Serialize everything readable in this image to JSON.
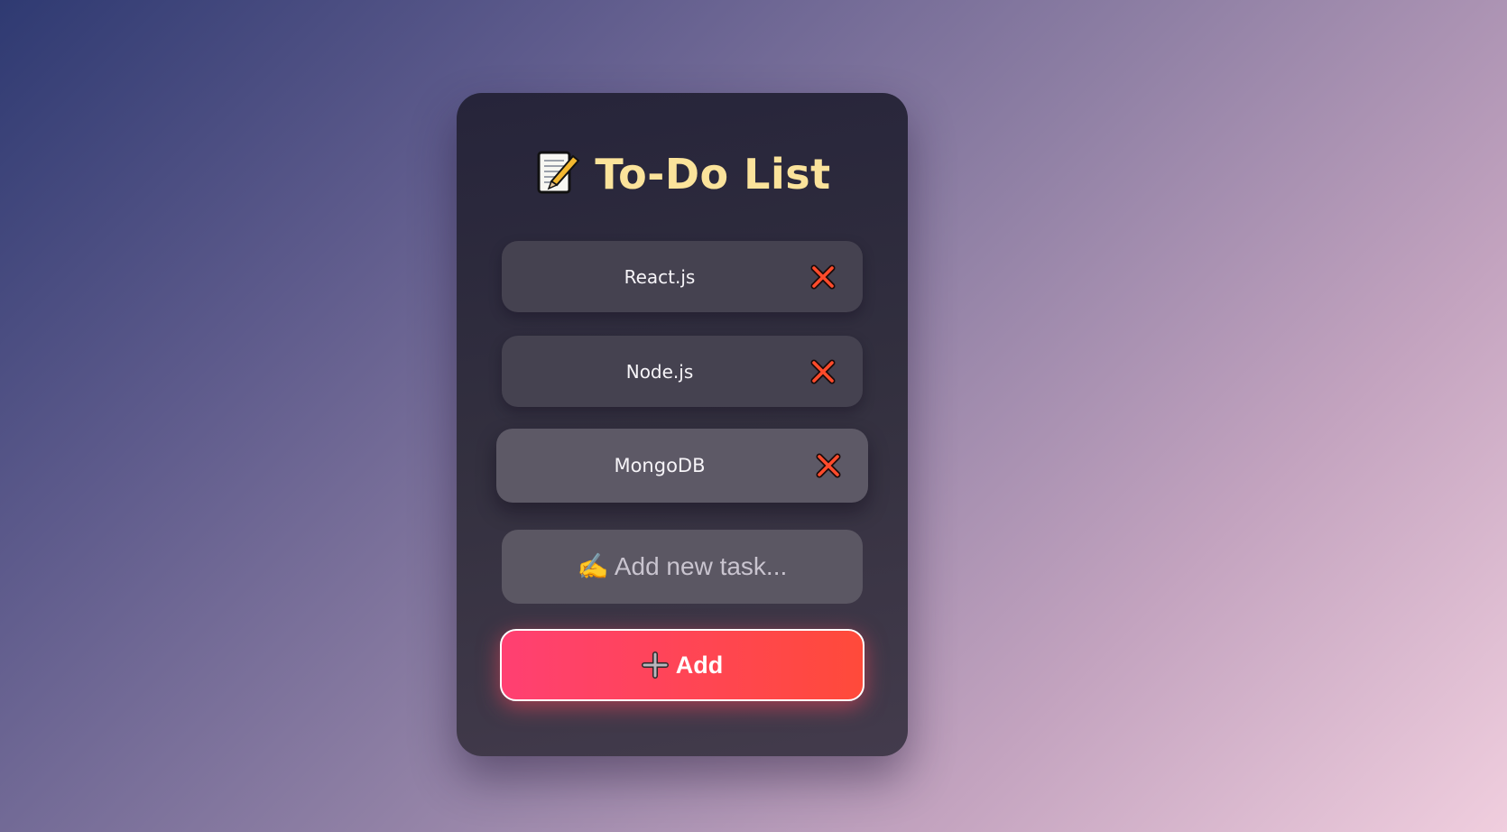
{
  "app": {
    "title": "To-Do List",
    "title_icon": "memo-icon"
  },
  "tasks": [
    {
      "label": "React.js",
      "delete_icon": "close-icon"
    },
    {
      "label": "Node.js",
      "delete_icon": "close-icon"
    },
    {
      "label": "MongoDB",
      "delete_icon": "close-icon",
      "state": "hover"
    }
  ],
  "new_task": {
    "value": "",
    "placeholder": "✍️ Add new task..."
  },
  "add_button": {
    "icon": "plus-icon",
    "label": "Add"
  },
  "colors": {
    "title": "#fbe39b",
    "delete": "#ff4b2b",
    "add_gradient_start": "#ff4072",
    "add_gradient_end": "#ff4a3a"
  }
}
